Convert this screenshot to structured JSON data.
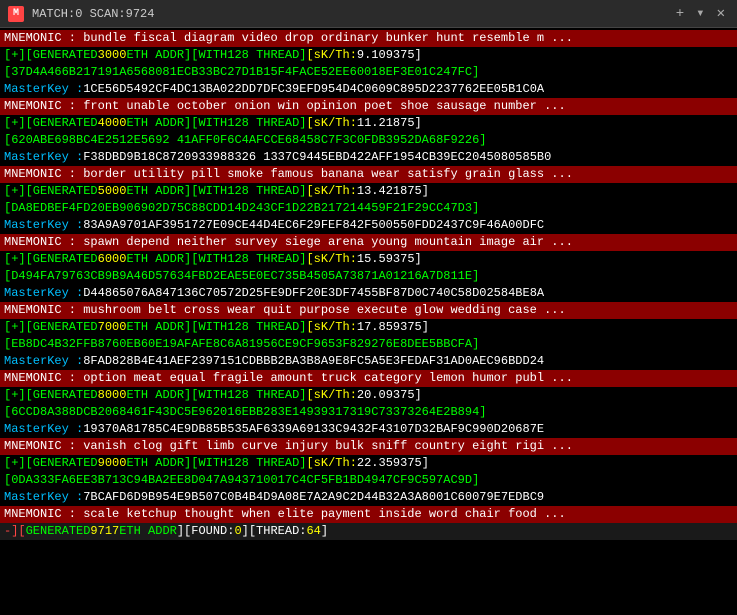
{
  "titlebar": {
    "icon": "M",
    "title": "MATCH:0 SCAN:9724",
    "close_label": "✕",
    "add_label": "+",
    "more_label": "▾"
  },
  "lines": [
    {
      "type": "mnemonic",
      "text": "MNEMONIC : bundle fiscal diagram video drop ordinary bunker hunt resemble m ..."
    },
    {
      "type": "generated",
      "prefix": "[+][GENERATED",
      "num": "3000",
      "eth": "ETH ADDR][WITH",
      "thread": "128 THREAD]",
      "sk": "[sK/Th:",
      "val": "9.109375]"
    },
    {
      "type": "addr",
      "text": "37D4A466B217191A6568081ECB33BC27D1B15F4FACE52EE60018EF3E01C247FC]"
    },
    {
      "type": "masterkey",
      "label": "MasterKey : ",
      "text": "1CE56D5492CF4DC13BA022DD7DFC39EFD954D4C0609C895D2237762EE05B1C0A"
    },
    {
      "type": "mnemonic",
      "text": "MNEMONIC : front unable october onion win opinion poet shoe sausage number ..."
    },
    {
      "type": "generated",
      "prefix": "[+][GENERATED",
      "num": "4000",
      "eth": "ETH ADDR][WITH",
      "thread": "128 THREAD]",
      "sk": "[sK/Th:",
      "val": "11.21875]"
    },
    {
      "type": "addr",
      "text": "620ABE698BC4E2512E5692 41AFF0F6C4AFCCE68458C7F3C0FDB3952DA68F9226]"
    },
    {
      "type": "masterkey",
      "label": "MasterKey : ",
      "text": "F38DBD9B18C8720933988326 1337C9445EBD422AFF1954CB39EC2045080585B0"
    },
    {
      "type": "mnemonic",
      "text": "MNEMONIC : border utility pill smoke famous banana wear satisfy grain glass ..."
    },
    {
      "type": "generated",
      "prefix": "[+][GENERATED",
      "num": "5000",
      "eth": "ETH ADDR][WITH",
      "thread": "128 THREAD]",
      "sk": "[sK/Th:",
      "val": "13.421875]"
    },
    {
      "type": "addr",
      "text": "DA8EDBEF4FD20EB906902D75C88CDD14D243CF1D22B217214459F21F29CC47D3]"
    },
    {
      "type": "masterkey",
      "label": "MasterKey : ",
      "text": "83A9A9701AF3951727E09CE44D4EC6F29FEF842F500550FDD2437C9F46A00DFC"
    },
    {
      "type": "mnemonic",
      "text": "MNEMONIC : spawn depend neither survey siege arena young mountain image air ..."
    },
    {
      "type": "generated",
      "prefix": "[+][GENERATED",
      "num": "6000",
      "eth": "ETH ADDR][WITH",
      "thread": "128 THREAD]",
      "sk": "[sK/Th:",
      "val": "15.59375]"
    },
    {
      "type": "addr",
      "text": "D494FA79763CB9B9A46D57634FBD2EAE5E0EC735B4505A73871A01216A7D811E]"
    },
    {
      "type": "masterkey",
      "label": "MasterKey : ",
      "text": "D44865076A847136C70572D25FE9DFF20E3DF7455BF87D0C740C58D02584BE8A"
    },
    {
      "type": "mnemonic",
      "text": "MNEMONIC : mushroom belt cross wear quit purpose execute glow wedding case ..."
    },
    {
      "type": "generated",
      "prefix": "[+][GENERATED",
      "num": "7000",
      "eth": "ETH ADDR][WITH",
      "thread": "128 THREAD]",
      "sk": "[sK/Th:",
      "val": "17.859375]"
    },
    {
      "type": "addr",
      "text": "EB8DC4B32FFB8760EB60E19AFAFE8C6A81956CE9CF9653F829276E8DEE5BBCFA]"
    },
    {
      "type": "masterkey",
      "label": "MasterKey : ",
      "text": "8FAD828B4E41AEF2397151CDBBB2BA3B8A9E8FC5A5E3FEDAF31AD0AEC96BDD24"
    },
    {
      "type": "mnemonic",
      "text": "MNEMONIC : option meat equal fragile amount truck category lemon humor publ ..."
    },
    {
      "type": "generated",
      "prefix": "[+][GENERATED",
      "num": "8000",
      "eth": "ETH ADDR][WITH",
      "thread": "128 THREAD]",
      "sk": "[sK/Th:",
      "val": "20.09375]"
    },
    {
      "type": "addr",
      "text": "6CCD8A388DCB2068461F43DC5E962016EBB283E14939317319C73373264E2B894]"
    },
    {
      "type": "masterkey",
      "label": "MasterKey : ",
      "text": "19370A81785C4E9DB85B535AF6339A69133C9432F43107D32BAF9C990D20687E"
    },
    {
      "type": "mnemonic",
      "text": "MNEMONIC : vanish clog gift limb curve injury bulk sniff country eight rigi ..."
    },
    {
      "type": "generated",
      "prefix": "[+][GENERATED",
      "num": "9000",
      "eth": "ETH ADDR][WITH",
      "thread": "128 THREAD]",
      "sk": "[sK/Th:",
      "val": "22.359375]"
    },
    {
      "type": "addr",
      "text": "0DA333FA6EE3B713C94BA2EE8D047A943710017C4CF5FB1BD4947CF9C597AC9D]"
    },
    {
      "type": "masterkey",
      "label": "MasterKey : ",
      "text": "7BCAFD6D9B954E9B507C0B4B4D9A08E7A2A9C2D44B32A3A8001C60079E7EDBC9"
    },
    {
      "type": "mnemonic",
      "text": "MNEMONIC : scale ketchup thought when elite payment inside word chair food ..."
    },
    {
      "type": "status",
      "neg_text": "-][",
      "gen_label": " GENERATED",
      "gen_num": "9717",
      "eth_text": "ETH ADDR",
      "found_label": "][FOUND:",
      "found_num": "0",
      "thread_label": "][THREAD:",
      "thread_num": "64",
      "close_bracket": "]"
    }
  ]
}
